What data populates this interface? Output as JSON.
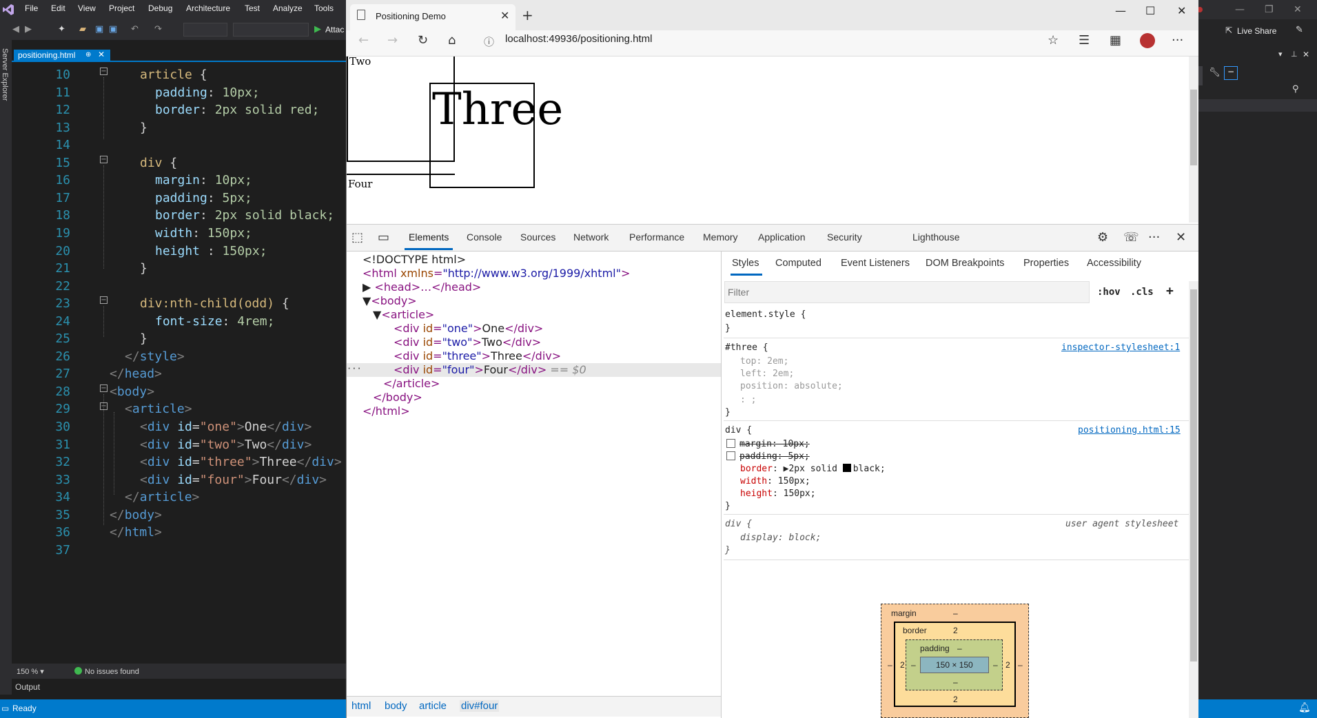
{
  "vs": {
    "menu": [
      "File",
      "Edit",
      "View",
      "Project",
      "Debug",
      "Architecture",
      "Test",
      "Analyze",
      "Tools"
    ],
    "attach_label": "Attac",
    "server_explorer": "Server Explorer",
    "file_tab": {
      "name": "positioning.html",
      "pin": "⊕",
      "close": "✕"
    },
    "zoom": "150 %",
    "issues": "No issues found",
    "output": "Output",
    "status": "Ready",
    "live_share": "Live Share"
  },
  "code_lines": [
    {
      "n": "10",
      "t": "article {"
    },
    {
      "n": "11",
      "t": "padding: 10px;"
    },
    {
      "n": "12",
      "t": "border: 2px solid red;"
    },
    {
      "n": "13",
      "t": "}"
    },
    {
      "n": "14",
      "t": ""
    },
    {
      "n": "15",
      "t": "div {"
    },
    {
      "n": "16",
      "t": "margin: 10px;"
    },
    {
      "n": "17",
      "t": "padding: 5px;"
    },
    {
      "n": "18",
      "t": "border: 2px solid black;"
    },
    {
      "n": "19",
      "t": "width: 150px;"
    },
    {
      "n": "20",
      "t": "height : 150px;"
    },
    {
      "n": "21",
      "t": "}"
    },
    {
      "n": "22",
      "t": ""
    },
    {
      "n": "23",
      "t": "div:nth-child(odd) {"
    },
    {
      "n": "24",
      "t": "font-size: 4rem;"
    },
    {
      "n": "25",
      "t": "}"
    },
    {
      "n": "26",
      "t": "</style>"
    },
    {
      "n": "27",
      "t": "</head>"
    },
    {
      "n": "28",
      "t": "<body>"
    },
    {
      "n": "29",
      "t": "<article>"
    },
    {
      "n": "30",
      "t": "<div id=\"one\">One</div>"
    },
    {
      "n": "31",
      "t": "<div id=\"two\">Two</div>"
    },
    {
      "n": "32",
      "t": "<div id=\"three\">Three</div>"
    },
    {
      "n": "33",
      "t": "<div id=\"four\">Four</div>"
    },
    {
      "n": "34",
      "t": "</article>"
    },
    {
      "n": "35",
      "t": "</body>"
    },
    {
      "n": "36",
      "t": "</html>"
    },
    {
      "n": "37",
      "t": ""
    }
  ],
  "browser": {
    "tab_title": "Positioning Demo",
    "address": "localhost:49936/positioning.html",
    "page": {
      "two": "Two",
      "three": "Three",
      "four": "Four"
    }
  },
  "devtools": {
    "tabs": [
      "Elements",
      "Console",
      "Sources",
      "Network",
      "Performance",
      "Memory",
      "Application",
      "Security",
      "Lighthouse"
    ],
    "active_tab": "Elements",
    "dom": {
      "doctype": "<!DOCTYPE html>",
      "html_open_tag": "<html",
      "html_attr": "xmlns",
      "html_val": "\"http://www.w3.org/1999/xhtml\"",
      "html_close": ">",
      "head": "<head>…</head>",
      "body_open": "<body>",
      "article_open": "<article>",
      "divs": [
        {
          "id": "one",
          "text": "One"
        },
        {
          "id": "two",
          "text": "Two"
        },
        {
          "id": "three",
          "text": "Three"
        },
        {
          "id": "four",
          "text": "Four"
        }
      ],
      "selected_marker": "== $0",
      "ellipsis": "···",
      "article_close": "</article>",
      "body_close": "</body>",
      "html_end": "</html>"
    },
    "breadcrumbs": [
      "html",
      "body",
      "article",
      "div#four"
    ],
    "styles_tabs": [
      "Styles",
      "Computed",
      "Event Listeners",
      "DOM Breakpoints",
      "Properties",
      "Accessibility"
    ],
    "filter_placeholder": "Filter",
    "hov": ":hov",
    "cls": ".cls",
    "plus": "+",
    "rules": {
      "element_style": "element.style {",
      "close": "}",
      "three_sel": "#three {",
      "three_src": "inspector-stylesheet:1",
      "three_top_p": "top",
      "three_top_v": "2em;",
      "three_left_p": "left",
      "three_left_v": "2em;",
      "three_pos_p": "position",
      "three_pos_v": "absolute;",
      "three_empty": ": ;",
      "div_sel": "div {",
      "div_src": "positioning.html:15",
      "div_margin": "margin: 10px;",
      "div_padding": "padding: 5px;",
      "div_border_p": "border",
      "div_border_v": "2px solid",
      "div_border_c": "black;",
      "div_width_p": "width",
      "div_width_v": "150px;",
      "div_height_p": "height",
      "div_height_v": "150px;",
      "ua_sel": "div {",
      "ua_src": "user agent stylesheet",
      "ua_display_p": "display",
      "ua_display_v": "block;"
    },
    "box_model": {
      "margin_label": "margin",
      "margin_value": "–",
      "border_label": "border",
      "border_value": "2",
      "padding_label": "padding",
      "padding_value": "–",
      "content": "150 × 150",
      "border_left": "2",
      "border_right": "2",
      "border_bottom": "2",
      "margin_left": "–",
      "margin_right": "–",
      "padding_left": "–",
      "padding_right": "–",
      "padding_bottom": "–"
    }
  },
  "colors": {
    "vs_blue": "#007acc",
    "devtools_blue": "#0067c0"
  }
}
